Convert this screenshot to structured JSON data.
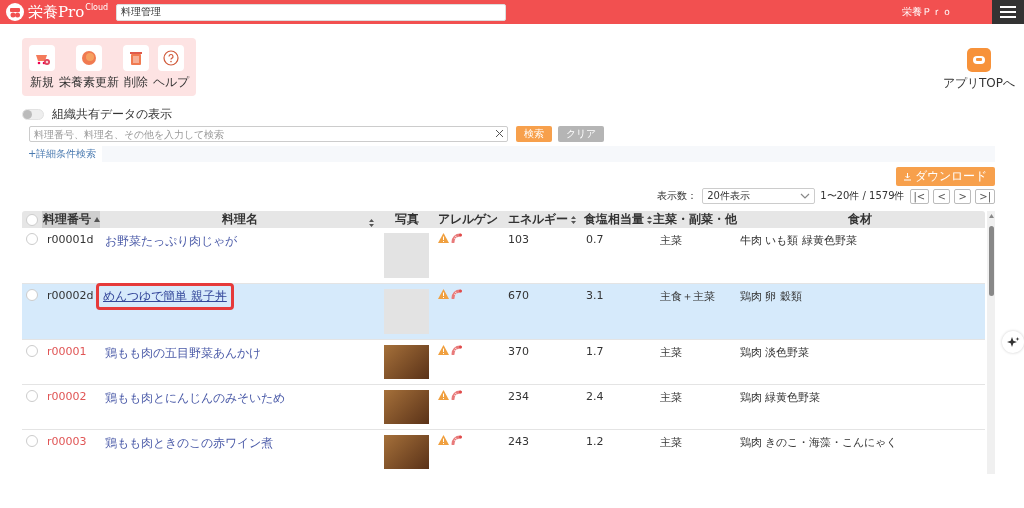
{
  "header": {
    "logo_text": "栄養Pro",
    "logo_badge": "Cloud",
    "search_value": "料理管理",
    "user_name": "栄養Ｐｒｏ"
  },
  "toolbar": {
    "buttons": [
      {
        "kind": "new",
        "label": "新規"
      },
      {
        "kind": "update",
        "label": "栄養素更新"
      },
      {
        "kind": "delete",
        "label": "削除"
      },
      {
        "kind": "help",
        "label": "ヘルプ"
      }
    ]
  },
  "app_top": {
    "label": "アプリTOPへ"
  },
  "shared_toggle": {
    "label": "組織共有データの表示",
    "on": false
  },
  "search": {
    "placeholder": "料理番号、料理名、その他を入力して検索",
    "search_button": "検索",
    "clear_button": "クリア",
    "advanced_link": "+詳細条件検索"
  },
  "download_button": "ダウンロード",
  "pagination": {
    "page_size_label": "表示数：",
    "page_size": "20件表示",
    "range": "1〜20件 / 1579件",
    "pager_buttons": [
      "|<",
      "<",
      ">",
      ">|"
    ]
  },
  "table": {
    "select_all_checked": false,
    "columns": [
      {
        "label": "料理番号",
        "sortable": true,
        "sorted": true
      },
      {
        "label": "料理名",
        "sortable": true,
        "sorted": false
      },
      {
        "label": "写真",
        "sortable": false,
        "sorted": false
      },
      {
        "label": "アレルゲン",
        "sortable": false,
        "sorted": false
      },
      {
        "label": "エネルギー",
        "sortable": true,
        "sorted": false
      },
      {
        "label": "食塩相当量",
        "sortable": true,
        "sorted": false
      },
      {
        "label": "主菜・副菜・他",
        "sortable": false,
        "sorted": false
      },
      {
        "label": "食材",
        "sortable": false,
        "sorted": false
      }
    ],
    "rows": [
      {
        "checked": false,
        "number": "r00001d",
        "color": "#333333",
        "name": "お野菜たっぷり肉じゃが",
        "has_photo": false,
        "energy": "103",
        "salt": "0.7",
        "category": "主菜",
        "ingredients": "牛肉 いも類 緑黄色野菜",
        "selected": false,
        "highlighted": false
      },
      {
        "checked": false,
        "number": "r00002d",
        "color": "#333333",
        "name": "めんつゆで簡単 親子丼",
        "has_photo": false,
        "energy": "670",
        "salt": "3.1",
        "category": "主食＋主菜",
        "ingredients": "鶏肉 卵 穀類",
        "selected": true,
        "highlighted": true
      },
      {
        "checked": false,
        "number": "r00001",
        "color": "#e05555",
        "name": "鶏もも肉の五目野菜あんかけ",
        "has_photo": true,
        "energy": "370",
        "salt": "1.7",
        "category": "主菜",
        "ingredients": "鶏肉 淡色野菜",
        "selected": false,
        "highlighted": false
      },
      {
        "checked": false,
        "number": "r00002",
        "color": "#e05555",
        "name": "鶏もも肉とにんじんのみそいため",
        "has_photo": true,
        "energy": "234",
        "salt": "2.4",
        "category": "主菜",
        "ingredients": "鶏肉 緑黄色野菜",
        "selected": false,
        "highlighted": false
      },
      {
        "checked": false,
        "number": "r00003",
        "color": "#e05555",
        "name": "鶏もも肉ときのこの赤ワイン煮",
        "has_photo": true,
        "energy": "243",
        "salt": "1.2",
        "category": "主菜",
        "ingredients": "鶏肉 きのこ・海藻・こんにゃく",
        "selected": false,
        "highlighted": false
      }
    ]
  }
}
